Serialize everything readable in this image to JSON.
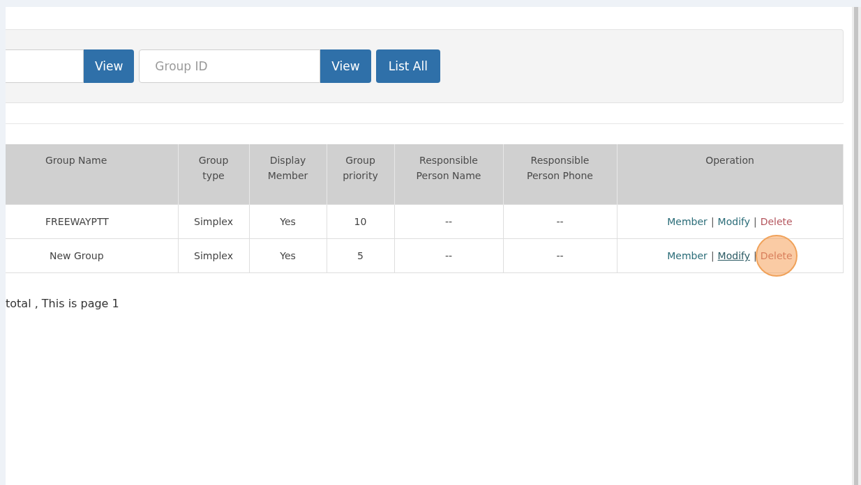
{
  "search_bar": {
    "controls": [
      {
        "kind": "input"
      },
      {
        "kind": "button",
        "label": "View"
      },
      {
        "kind": "input",
        "placeholder": "Group ID"
      },
      {
        "kind": "button",
        "label": "View"
      },
      {
        "kind": "button",
        "label": "List All"
      }
    ]
  },
  "table": {
    "operation_separator": "|",
    "columns": [
      "Group Name",
      "Group type",
      "Display Member",
      "Group priority",
      "Responsible Person Name",
      "Responsible Person Phone",
      "Operation"
    ],
    "rows": [
      {
        "cells": [
          "FREEWAYPTT",
          "Simplex",
          "Yes",
          "10",
          "--",
          "--"
        ],
        "operations": [
          {
            "kind": "normal",
            "label": "Member",
            "hovered": false,
            "clicked": false
          },
          {
            "kind": "normal",
            "label": "Modify",
            "hovered": false,
            "clicked": false
          },
          {
            "kind": "danger",
            "label": "Delete",
            "hovered": false,
            "clicked": false
          }
        ]
      },
      {
        "cells": [
          "New Group",
          "Simplex",
          "Yes",
          "5",
          "--",
          "--"
        ],
        "operations": [
          {
            "kind": "normal",
            "label": "Member",
            "hovered": false,
            "clicked": false
          },
          {
            "kind": "normal",
            "label": "Modify",
            "hovered": true,
            "clicked": false
          },
          {
            "kind": "danger",
            "label": "Delete",
            "hovered": false,
            "clicked": true
          }
        ]
      }
    ]
  },
  "pagination_text": "total , This is page 1"
}
